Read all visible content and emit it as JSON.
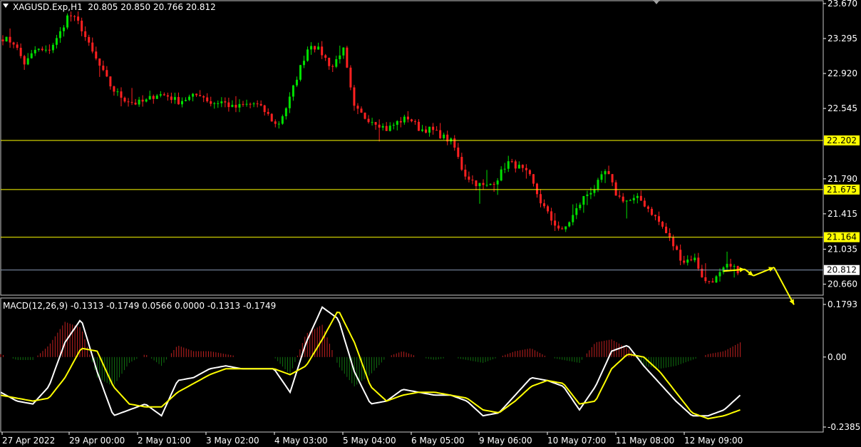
{
  "header": {
    "symbol": "XAGUSD.Exp,H1",
    "ohlc": "20.805 20.850 20.766 20.812"
  },
  "macd_header": {
    "label": "MACD(12,26,9) -0.1313 -0.1749 0.0566 0.0000 -0.1313 -0.1749"
  },
  "colors": {
    "background": "#000000",
    "bull": "#00e000",
    "bear": "#ff2020",
    "level_line": "#ffff00",
    "current_line": "#8a9bb8",
    "macd_main": "#ffffff",
    "macd_signal": "#ffff00",
    "hist_pos": "#c02020",
    "hist_neg": "#107010",
    "arrow": "#ffff00"
  },
  "chart_data": [
    {
      "type": "candlestick",
      "symbol": "XAGUSD.Exp",
      "timeframe": "H1",
      "ylim": [
        20.55,
        23.67
      ],
      "y_ticks": [
        "23.670",
        "23.295",
        "22.920",
        "22.545",
        "21.790",
        "21.415",
        "21.035",
        "20.660"
      ],
      "x_ticks": [
        "27 Apr 2022",
        "29 Apr 00:00",
        "2 May 01:00",
        "3 May 02:00",
        "4 May 03:00",
        "5 May 04:00",
        "6 May 05:00",
        "9 May 06:00",
        "10 May 07:00",
        "11 May 08:00",
        "12 May 09:00"
      ],
      "close_anchors": [
        23.3,
        23.25,
        23.02,
        23.18,
        23.15,
        23.3,
        23.56,
        23.45,
        23.18,
        22.96,
        22.75,
        22.65,
        22.6,
        22.62,
        22.7,
        22.68,
        22.62,
        22.66,
        22.7,
        22.6,
        22.62,
        22.55,
        22.58,
        22.6,
        22.5,
        22.35,
        22.6,
        22.95,
        23.25,
        23.15,
        22.98,
        23.2,
        22.55,
        22.45,
        22.4,
        22.32,
        22.4,
        22.45,
        22.32,
        22.32,
        22.25,
        22.18,
        21.85,
        21.75,
        21.7,
        21.78,
        21.97,
        21.92,
        21.82,
        21.55,
        21.35,
        21.22,
        21.4,
        21.6,
        21.7,
        21.88,
        21.6,
        21.55,
        21.58,
        21.45,
        21.3,
        21.1,
        20.9,
        20.95,
        20.68,
        20.72,
        20.85,
        20.81
      ],
      "levels": [
        {
          "label": "22.202",
          "value": 22.202
        },
        {
          "label": "21.675",
          "value": 21.675
        },
        {
          "label": "21.164",
          "value": 21.164
        }
      ],
      "current_price": {
        "label": "20.812",
        "value": 20.812
      },
      "forecast_arrows": [
        {
          "from": [
            1015,
            20.8
          ],
          "to": [
            1045,
            20.82
          ]
        },
        {
          "from": [
            1045,
            20.82
          ],
          "to": [
            1057,
            20.75
          ]
        },
        {
          "from": [
            1057,
            20.75
          ],
          "to": [
            1086,
            20.84
          ]
        },
        {
          "from": [
            1086,
            20.84
          ],
          "to": [
            1114,
            20.44
          ]
        }
      ]
    },
    {
      "type": "macd",
      "params": "12,26,9",
      "ylim": [
        -0.2385,
        0.1793
      ],
      "y_ticks": [
        "0.1793",
        "0.00",
        "-0.2385"
      ],
      "main_anchors": [
        -0.12,
        -0.15,
        -0.16,
        -0.1,
        0.05,
        0.13,
        -0.05,
        -0.2,
        -0.18,
        -0.16,
        -0.2,
        -0.08,
        -0.07,
        -0.04,
        -0.03,
        -0.04,
        -0.04,
        -0.04,
        -0.12,
        0.05,
        0.17,
        0.13,
        -0.05,
        -0.16,
        -0.15,
        -0.11,
        -0.12,
        -0.13,
        -0.13,
        -0.15,
        -0.2,
        -0.19,
        -0.13,
        -0.07,
        -0.08,
        -0.1,
        -0.18,
        -0.1,
        0.02,
        0.04,
        -0.03,
        -0.09,
        -0.15,
        -0.2,
        -0.2,
        -0.18,
        -0.13
      ],
      "signal_anchors": [
        -0.13,
        -0.14,
        -0.15,
        -0.14,
        -0.07,
        0.03,
        0.02,
        -0.1,
        -0.16,
        -0.17,
        -0.17,
        -0.12,
        -0.09,
        -0.06,
        -0.04,
        -0.04,
        -0.04,
        -0.04,
        -0.06,
        -0.03,
        0.06,
        0.16,
        0.05,
        -0.1,
        -0.15,
        -0.13,
        -0.12,
        -0.12,
        -0.13,
        -0.14,
        -0.18,
        -0.19,
        -0.15,
        -0.1,
        -0.08,
        -0.09,
        -0.16,
        -0.15,
        -0.04,
        0.01,
        0.0,
        -0.05,
        -0.12,
        -0.19,
        -0.21,
        -0.2,
        -0.18
      ]
    }
  ]
}
